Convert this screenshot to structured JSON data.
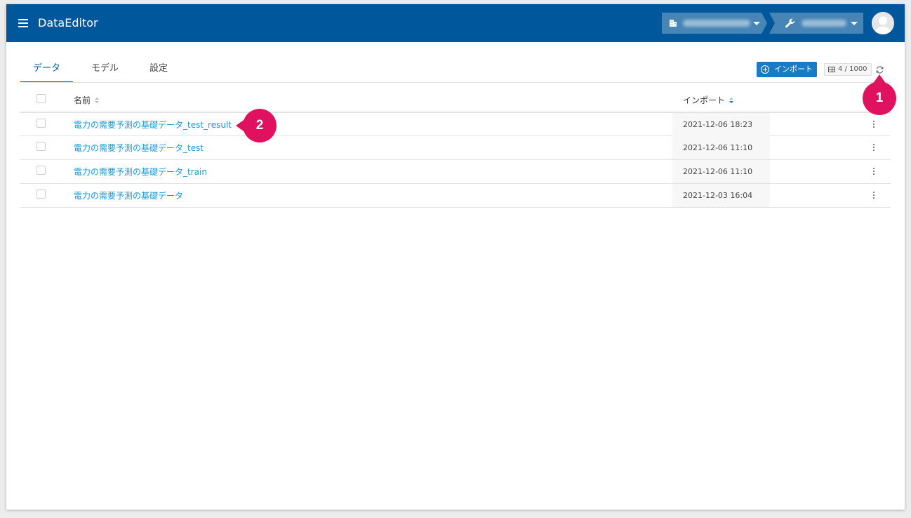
{
  "header": {
    "app_title": "DataEditor",
    "accent": "#01579b"
  },
  "tabs": [
    {
      "label": "データ",
      "active": true
    },
    {
      "label": "モデル",
      "active": false
    },
    {
      "label": "設定",
      "active": false
    }
  ],
  "toolbar": {
    "import_label": "インポート",
    "count_label": "4 / 1000"
  },
  "table": {
    "headers": {
      "name": "名前",
      "import": "インポート"
    },
    "rows": [
      {
        "name": "電力の需要予測の基礎データ_test_result",
        "date": "2021-12-06 18:23"
      },
      {
        "name": "電力の需要予測の基礎データ_test",
        "date": "2021-12-06 11:10"
      },
      {
        "name": "電力の需要予測の基礎データ_train",
        "date": "2021-12-06 11:10"
      },
      {
        "name": "電力の需要予測の基礎データ",
        "date": "2021-12-03 16:04"
      }
    ]
  },
  "callouts": {
    "one": "1",
    "two": "2",
    "color": "#e0115f"
  }
}
